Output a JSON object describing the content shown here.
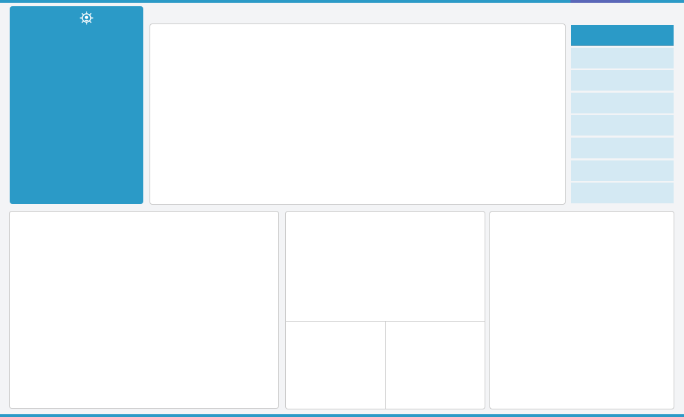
{
  "colors": {
    "primary": "#2b9ac7",
    "accent": "#5a67b8",
    "menu_item_inactive": "#d4e9f3",
    "panel_background": "#ffffff",
    "page_background": "#f3f4f6"
  },
  "profile": {
    "icon": "gear-icon"
  },
  "side_menu": {
    "items": [
      {
        "state": "active"
      },
      {
        "state": "inactive"
      },
      {
        "state": "inactive"
      },
      {
        "state": "inactive"
      },
      {
        "state": "inactive"
      },
      {
        "state": "inactive"
      },
      {
        "state": "inactive"
      },
      {
        "state": "inactive"
      }
    ]
  }
}
